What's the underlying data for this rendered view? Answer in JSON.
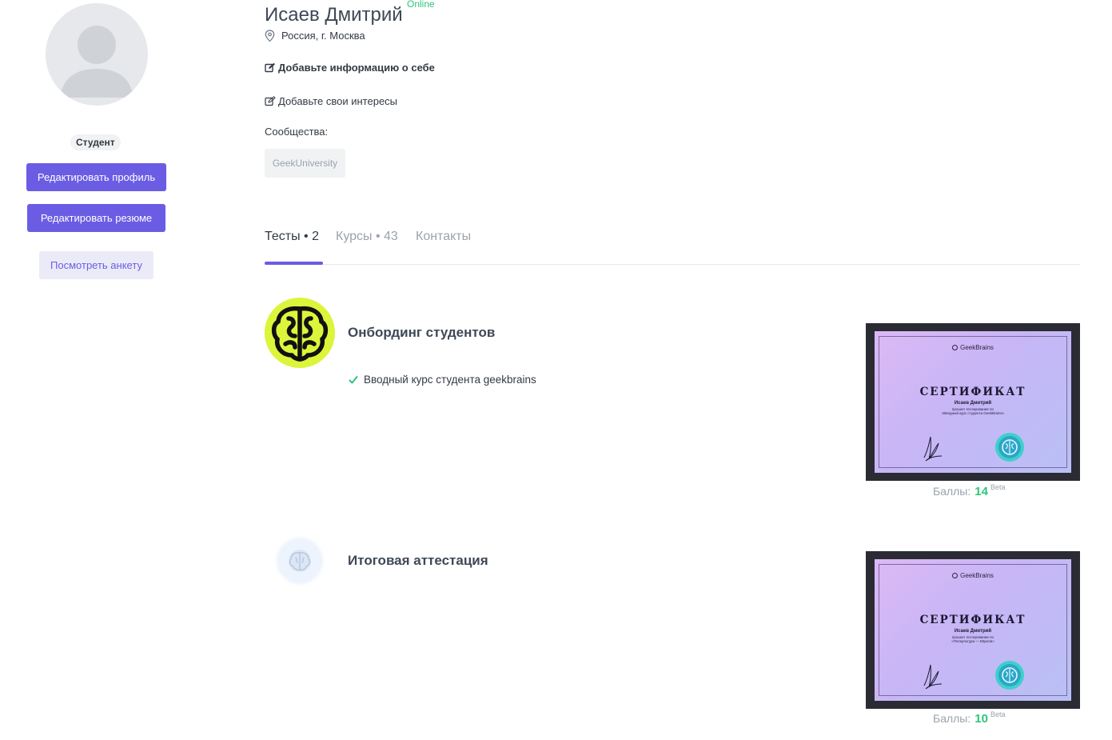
{
  "sidebar": {
    "avatar_icon": "user-silhouette-icon",
    "role": "Студент",
    "edit_profile_label": "Редактировать профиль",
    "edit_resume_label": "Редактировать резюме",
    "view_profile_label": "Посмотреть анкету"
  },
  "profile": {
    "name": "Исаев Дмитрий",
    "status": "Online",
    "location_icon": "map-pin-icon",
    "location": "Россия, г. Москва",
    "about_prompt": "Добавьте информацию о себе",
    "interests_prompt": "Добавьте свои интересы",
    "communities_label": "Сообщества:",
    "communities": [
      "GeekUniversity"
    ]
  },
  "tabs": [
    {
      "label": "Тесты • 2",
      "active": true
    },
    {
      "label": "Курсы • 43",
      "active": false
    },
    {
      "label": "Контакты",
      "active": false
    }
  ],
  "tests": [
    {
      "title": "Онбординг студентов",
      "logo_icon": "brain-logo-icon",
      "completed_course": "Вводный курс студента geekbrains",
      "certificate": {
        "brand": "GeekBrains",
        "heading": "СЕРТИФИКАТ",
        "person": "Исаев Дмитрий",
        "line1": "прошел тестирование по",
        "line2": "«Вводный курс студента GeekBrains»"
      },
      "score_label": "Баллы:",
      "score": "14",
      "score_badge": "Beta"
    },
    {
      "title": "Итоговая аттестация",
      "logo_icon": "brain-logo-faded-icon",
      "certificate": {
        "brand": "GeekBrains",
        "heading": "СЕРТИФИКАТ",
        "person": "Исаев Дмитрий",
        "line1": "прошел тестирование по",
        "line2": "«Попкультура — Европа»"
      },
      "score_label": "Баллы:",
      "score": "10",
      "score_badge": "Beta"
    }
  ],
  "colors": {
    "accent": "#6b5ce4",
    "online": "#2fc47b",
    "score": "#2fc47b",
    "logo_bg": "#dcf53a"
  }
}
